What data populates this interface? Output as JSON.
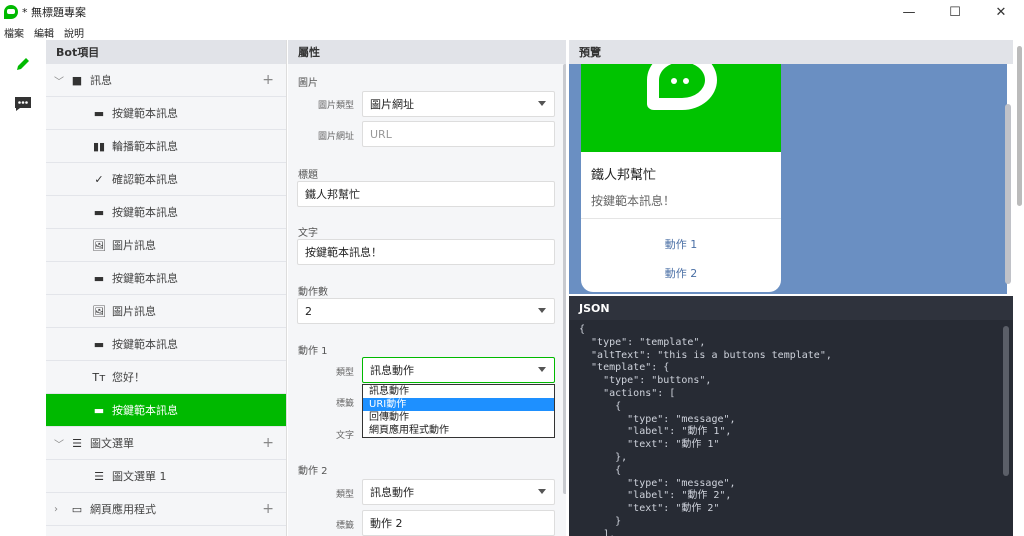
{
  "window": {
    "title": "* 無標題專案",
    "minimize": "—",
    "maximize": "☐",
    "close": "✕"
  },
  "menu": [
    "檔案",
    "編輯",
    "說明"
  ],
  "activity": {
    "edit_icon": "pencil-icon",
    "chat_icon": "chat-icon"
  },
  "sidebar": {
    "header": "Bot項目",
    "groups": [
      {
        "label": "訊息",
        "icon": "message-icon",
        "expanded": true
      },
      {
        "label": "圖文選單",
        "icon": "list-icon",
        "expanded": true
      },
      {
        "label": "網頁應用程式",
        "icon": "webapp-icon",
        "expanded": false
      }
    ],
    "messages": [
      {
        "label": "按鍵範本訊息",
        "icon": "▬"
      },
      {
        "label": "輪播範本訊息",
        "icon": "▮▮"
      },
      {
        "label": "確認範本訊息",
        "icon": "✓"
      },
      {
        "label": "按鍵範本訊息",
        "icon": "▬"
      },
      {
        "label": "圖片訊息",
        "icon": "🖼"
      },
      {
        "label": "按鍵範本訊息",
        "icon": "▬"
      },
      {
        "label": "圖片訊息",
        "icon": "🖼"
      },
      {
        "label": "按鍵範本訊息",
        "icon": "▬"
      },
      {
        "label": "您好！",
        "icon": "Tт"
      },
      {
        "label": "按鍵範本訊息",
        "icon": "▬",
        "selected": true
      }
    ],
    "menus": [
      {
        "label": "圖文選單 1",
        "icon": "☰"
      }
    ]
  },
  "props": {
    "header": "屬性",
    "image_section": "圖片",
    "image_type_label": "圖片類型",
    "image_type_value": "圖片網址",
    "image_url_label": "圖片網址",
    "image_url_placeholder": "URL",
    "title_section": "標題",
    "title_value": "鐵人邦幫忙",
    "text_section": "文字",
    "text_value": "按鍵範本訊息！",
    "count_section": "動作數",
    "count_value": "2",
    "action1_section": "動作 1",
    "action1_type_label": "類型",
    "action1_type_value": "訊息動作",
    "action1_label_label": "標籤",
    "action1_text_label": "文字",
    "dropdown_options": [
      "訊息動作",
      "URI動作",
      "回傳動作",
      "網頁應用程式動作"
    ],
    "dropdown_highlight": 1,
    "action2_section": "動作 2",
    "action2_type_label": "類型",
    "action2_type_value": "訊息動作",
    "action2_label_label": "標籤",
    "action2_label_value": "動作 2"
  },
  "preview": {
    "header": "預覽",
    "card_title": "鐵人邦幫忙",
    "card_text": "按鍵範本訊息！",
    "action1": "動作 1",
    "action2": "動作 2",
    "bg_color": "#6a8fc2",
    "hero_color": "#00c300"
  },
  "json_panel": {
    "header": "JSON",
    "code": "{\n  \"type\": \"template\",\n  \"altText\": \"this is a buttons template\",\n  \"template\": {\n    \"type\": \"buttons\",\n    \"actions\": [\n      {\n        \"type\": \"message\",\n        \"label\": \"動作 1\",\n        \"text\": \"動作 1\"\n      },\n      {\n        \"type\": \"message\",\n        \"label\": \"動作 2\",\n        \"text\": \"動作 2\"\n      }\n    ],"
  },
  "colors": {
    "accent": "#00b900",
    "highlight": "#1e90ff"
  }
}
